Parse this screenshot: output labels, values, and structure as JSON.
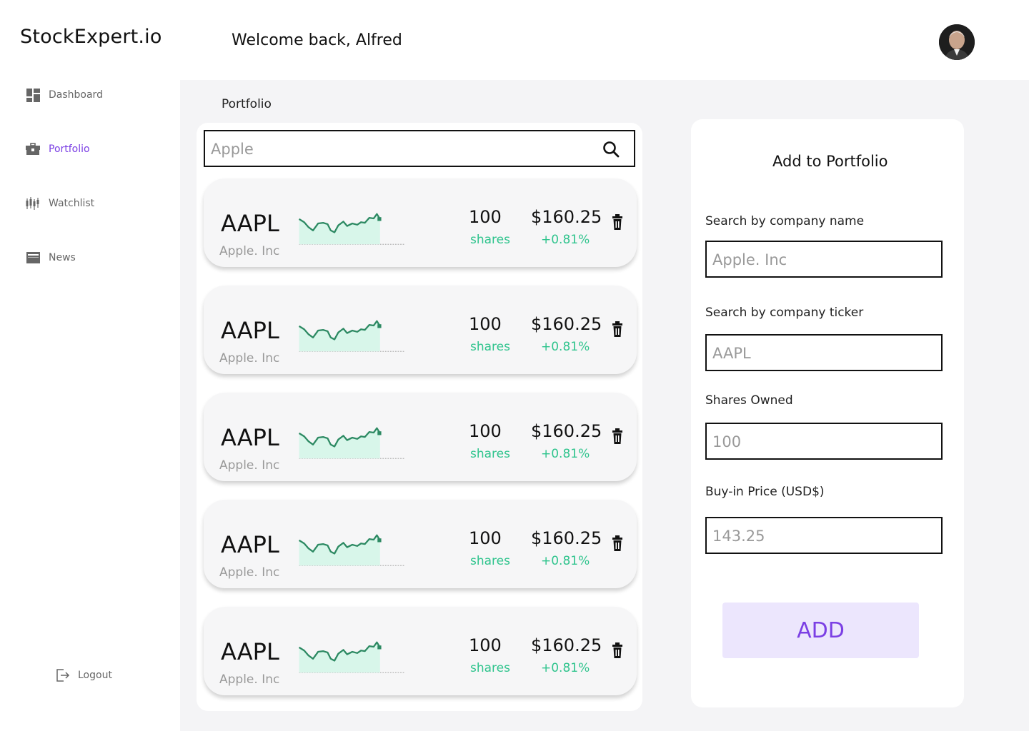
{
  "app": {
    "brand": "StockExpert.io",
    "welcome": "Welcome back, Alfred"
  },
  "sidebar": {
    "items": [
      {
        "label": "Dashboard",
        "icon": "dashboard-icon"
      },
      {
        "label": "Portfolio",
        "icon": "briefcase-icon",
        "active": true
      },
      {
        "label": "Watchlist",
        "icon": "candlestick-icon"
      },
      {
        "label": "News",
        "icon": "news-icon"
      }
    ],
    "logout": "Logout"
  },
  "portfolio": {
    "title": "Portfolio",
    "search_placeholder": "Apple",
    "stocks": [
      {
        "ticker": "AAPL",
        "company": "Apple. Inc",
        "shares": "100",
        "shares_label": "shares",
        "price": "$160.25",
        "change": "+0.81%"
      },
      {
        "ticker": "AAPL",
        "company": "Apple. Inc",
        "shares": "100",
        "shares_label": "shares",
        "price": "$160.25",
        "change": "+0.81%"
      },
      {
        "ticker": "AAPL",
        "company": "Apple. Inc",
        "shares": "100",
        "shares_label": "shares",
        "price": "$160.25",
        "change": "+0.81%"
      },
      {
        "ticker": "AAPL",
        "company": "Apple. Inc",
        "shares": "100",
        "shares_label": "shares",
        "price": "$160.25",
        "change": "+0.81%"
      },
      {
        "ticker": "AAPL",
        "company": "Apple. Inc",
        "shares": "100",
        "shares_label": "shares",
        "price": "$160.25",
        "change": "+0.81%"
      }
    ]
  },
  "add_form": {
    "title": "Add to Portfolio",
    "company_name_label": "Search by company name",
    "company_name_placeholder": "Apple. Inc",
    "ticker_label": "Search by company ticker",
    "ticker_placeholder": "AAPL",
    "shares_label": "Shares Owned",
    "shares_placeholder": "100",
    "price_label": "Buy-in Price (USD$)",
    "price_placeholder": "143.25",
    "add_button": "ADD"
  },
  "colors": {
    "accent": "#7b3fe4",
    "positive": "#2fc48d",
    "button_bg": "#ece6fd",
    "main_bg": "#f4f4f6"
  }
}
